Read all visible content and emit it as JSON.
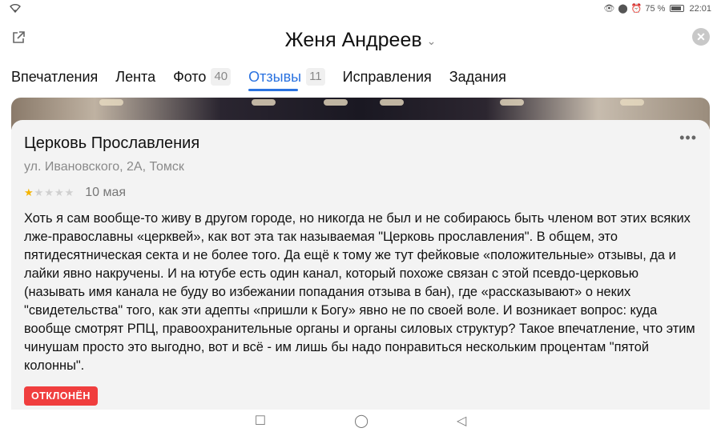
{
  "statusbar": {
    "battery": "75 %",
    "time": "22:01"
  },
  "header": {
    "title": "Женя Андреев"
  },
  "tabs": [
    {
      "label": "Впечатления",
      "count": ""
    },
    {
      "label": "Лента",
      "count": ""
    },
    {
      "label": "Фото",
      "count": "40"
    },
    {
      "label": "Отзывы",
      "count": "11",
      "active": true
    },
    {
      "label": "Исправления",
      "count": ""
    },
    {
      "label": "Задания",
      "count": ""
    }
  ],
  "review": {
    "organization": "Церковь Прославления",
    "address": "ул. Ивановского, 2А, Томск",
    "rating": 1,
    "rating_max": 5,
    "date": "10 мая",
    "text": "Хоть я сам вообще-то живу в другом городе, но никогда не был и не собираюсь быть членом вот этих всяких лже-православны «церквей», как вот эта так называемая \"Церковь прославления\". В общем, это пятидесятническая секта и не более того. Да ещё к тому же тут фейковые «положительные» отзывы, да и лайки явно накручены. И на ютубе есть один канал, который похоже связан с этой псевдо-церковью (называть имя канала не буду во избежании попадания отзыва в бан), где «рассказывают» о неких \"свидетельства\" того, как эти адепты «пришли к Богу» явно не по своей воле. И возникает вопрос: куда вообще смотрят РПЦ, правоохранительные органы и органы силовых структур? Такое впечатление, что этим чинушам просто это выгодно, вот и всё - им лишь бы надо понравиться нескольким процентам \"пятой колонны\".",
    "status_badge": "ОТКЛОНЁН"
  },
  "colors": {
    "accent": "#2a72e0",
    "rejected": "#f03e3e",
    "star": "#f4b400"
  }
}
